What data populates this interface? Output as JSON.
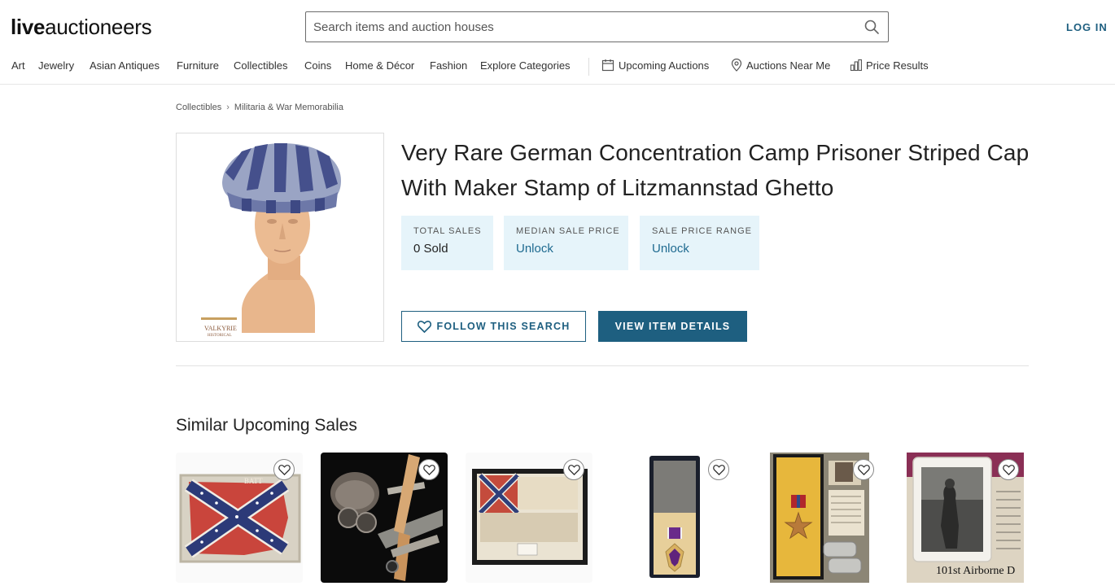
{
  "header": {
    "logo_bold": "live",
    "logo_light": "auctioneers",
    "search_placeholder": "Search items and auction houses",
    "login_label": "LOG IN"
  },
  "nav": {
    "categories": [
      "Art",
      "Jewelry",
      "Asian Antiques",
      "Furniture",
      "Collectibles",
      "Coins",
      "Home & Décor",
      "Fashion",
      "Explore Categories"
    ],
    "upcoming": "Upcoming Auctions",
    "near_me": "Auctions Near Me",
    "price_results": "Price Results"
  },
  "breadcrumb": [
    "Collectibles",
    "Militaria & War Memorabilia"
  ],
  "item": {
    "title": "Very Rare German Concentration Camp Prisoner Striped Cap With Maker Stamp of Litzmannstad Ghetto"
  },
  "stats": [
    {
      "label": "TOTAL SALES",
      "value": "0 Sold"
    },
    {
      "label": "MEDIAN SALE PRICE",
      "value": "Unlock"
    },
    {
      "label": "SALE PRICE RANGE",
      "value": "Unlock"
    }
  ],
  "actions": {
    "follow": "FOLLOW THIS SEARCH",
    "view": "VIEW ITEM DETAILS"
  },
  "similar": {
    "title": "Similar Upcoming Sales",
    "items": [
      {
        "caption": "Confederate battle flag, framed",
        "icon": "flag-image"
      },
      {
        "caption": "Early aviation items",
        "icon": "airplane-image"
      },
      {
        "caption": "Confederate flag fragment, framed",
        "icon": "flag-image"
      },
      {
        "caption": "Purple Heart medal in case",
        "icon": "medal-image"
      },
      {
        "caption": "Bronze Star medal with dog tags",
        "icon": "medal-image"
      },
      {
        "caption": "101st Airborne photograph",
        "icon": "photo-image"
      }
    ],
    "partial_text": "101st Airborne D"
  },
  "colors": {
    "brand": "#1e5f80",
    "stat_bg": "#e6f4fa"
  }
}
